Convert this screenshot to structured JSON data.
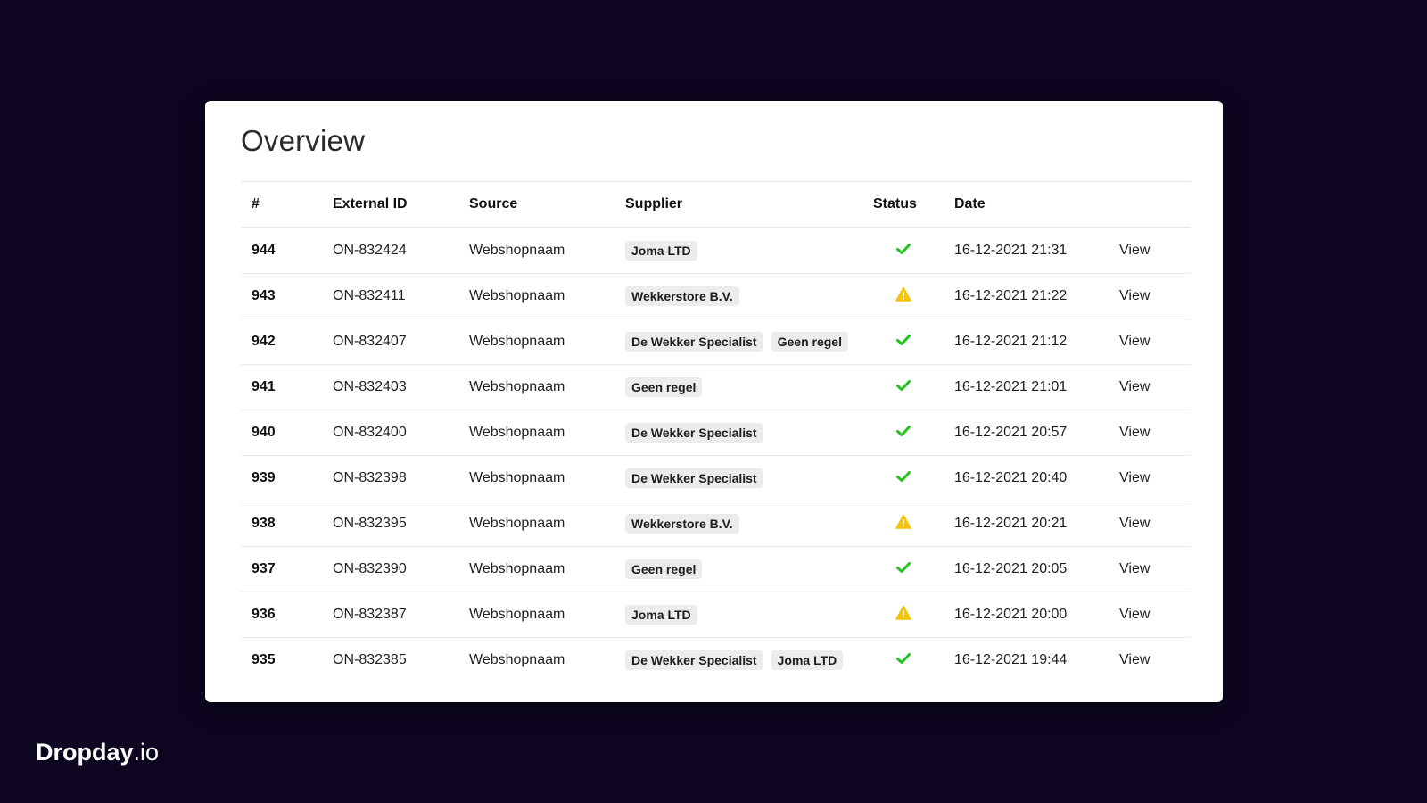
{
  "page": {
    "title": "Overview"
  },
  "colors": {
    "background": "#0e0621",
    "check": "#22c51e",
    "warning": "#f5c400"
  },
  "table": {
    "headers": [
      "#",
      "External ID",
      "Source",
      "Supplier",
      "Status",
      "Date",
      ""
    ],
    "rows": [
      {
        "num": "944",
        "ext": "ON-832424",
        "source": "Webshopnaam",
        "suppliers": [
          "Joma LTD"
        ],
        "status": "check-icon",
        "date": "16-12-2021 21:31",
        "action": "View"
      },
      {
        "num": "943",
        "ext": "ON-832411",
        "source": "Webshopnaam",
        "suppliers": [
          "Wekkerstore B.V."
        ],
        "status": "warning-icon",
        "date": "16-12-2021 21:22",
        "action": "View"
      },
      {
        "num": "942",
        "ext": "ON-832407",
        "source": "Webshopnaam",
        "suppliers": [
          "De Wekker Specialist",
          "Geen regel"
        ],
        "status": "check-icon",
        "date": "16-12-2021 21:12",
        "action": "View"
      },
      {
        "num": "941",
        "ext": "ON-832403",
        "source": "Webshopnaam",
        "suppliers": [
          "Geen regel"
        ],
        "status": "check-icon",
        "date": "16-12-2021 21:01",
        "action": "View"
      },
      {
        "num": "940",
        "ext": "ON-832400",
        "source": "Webshopnaam",
        "suppliers": [
          "De Wekker Specialist"
        ],
        "status": "check-icon",
        "date": "16-12-2021 20:57",
        "action": "View"
      },
      {
        "num": "939",
        "ext": "ON-832398",
        "source": "Webshopnaam",
        "suppliers": [
          "De Wekker Specialist"
        ],
        "status": "check-icon",
        "date": "16-12-2021 20:40",
        "action": "View"
      },
      {
        "num": "938",
        "ext": "ON-832395",
        "source": "Webshopnaam",
        "suppliers": [
          "Wekkerstore B.V."
        ],
        "status": "warning-icon",
        "date": "16-12-2021 20:21",
        "action": "View"
      },
      {
        "num": "937",
        "ext": "ON-832390",
        "source": "Webshopnaam",
        "suppliers": [
          "Geen regel"
        ],
        "status": "check-icon",
        "date": "16-12-2021 20:05",
        "action": "View"
      },
      {
        "num": "936",
        "ext": "ON-832387",
        "source": "Webshopnaam",
        "suppliers": [
          "Joma LTD"
        ],
        "status": "warning-icon",
        "date": "16-12-2021 20:00",
        "action": "View"
      },
      {
        "num": "935",
        "ext": "ON-832385",
        "source": "Webshopnaam",
        "suppliers": [
          "De Wekker Specialist",
          "Joma LTD"
        ],
        "status": "check-icon",
        "date": "16-12-2021 19:44",
        "action": "View"
      }
    ]
  },
  "brand": {
    "name": "Dropday",
    "tld": ".io"
  }
}
